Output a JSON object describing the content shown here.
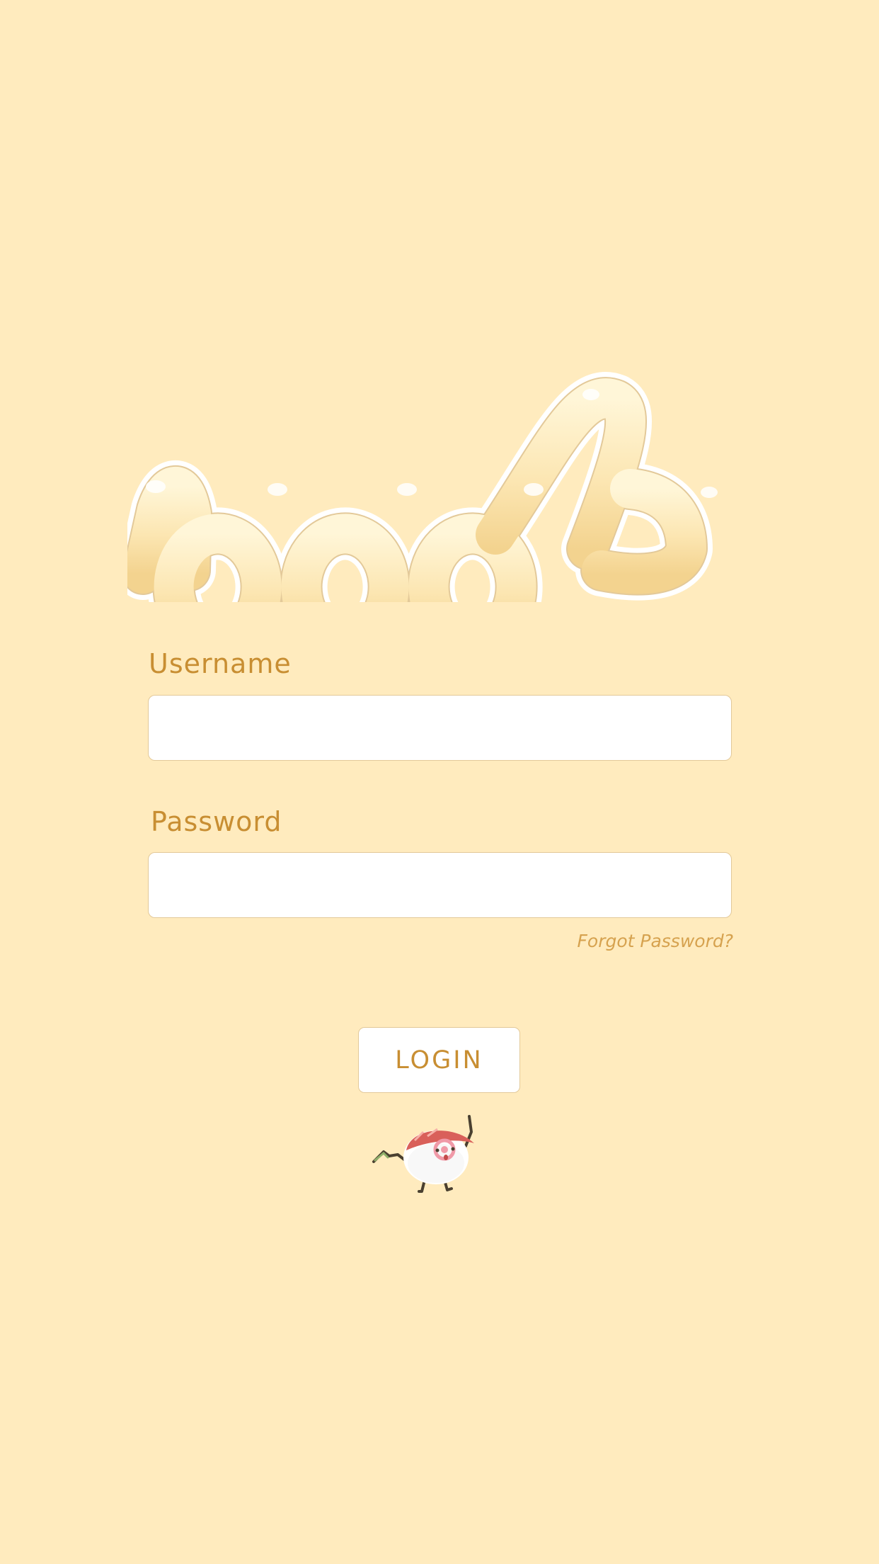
{
  "app": {
    "logo_text": "noods"
  },
  "form": {
    "username_label": "Username",
    "username_value": "",
    "password_label": "Password",
    "password_value": "",
    "forgot_password_label": "Forgot Password?",
    "login_label": "LOGIN"
  },
  "mascot": {
    "icon": "naruto-fishcake-mascot-icon"
  },
  "colors": {
    "background": "#FFEBBE",
    "accent_text": "#C88E32",
    "link_text": "#D6A24F",
    "input_border": "#E3C999",
    "logo_fill": "#FCE6B2",
    "logo_outline": "#FFFFFF"
  }
}
